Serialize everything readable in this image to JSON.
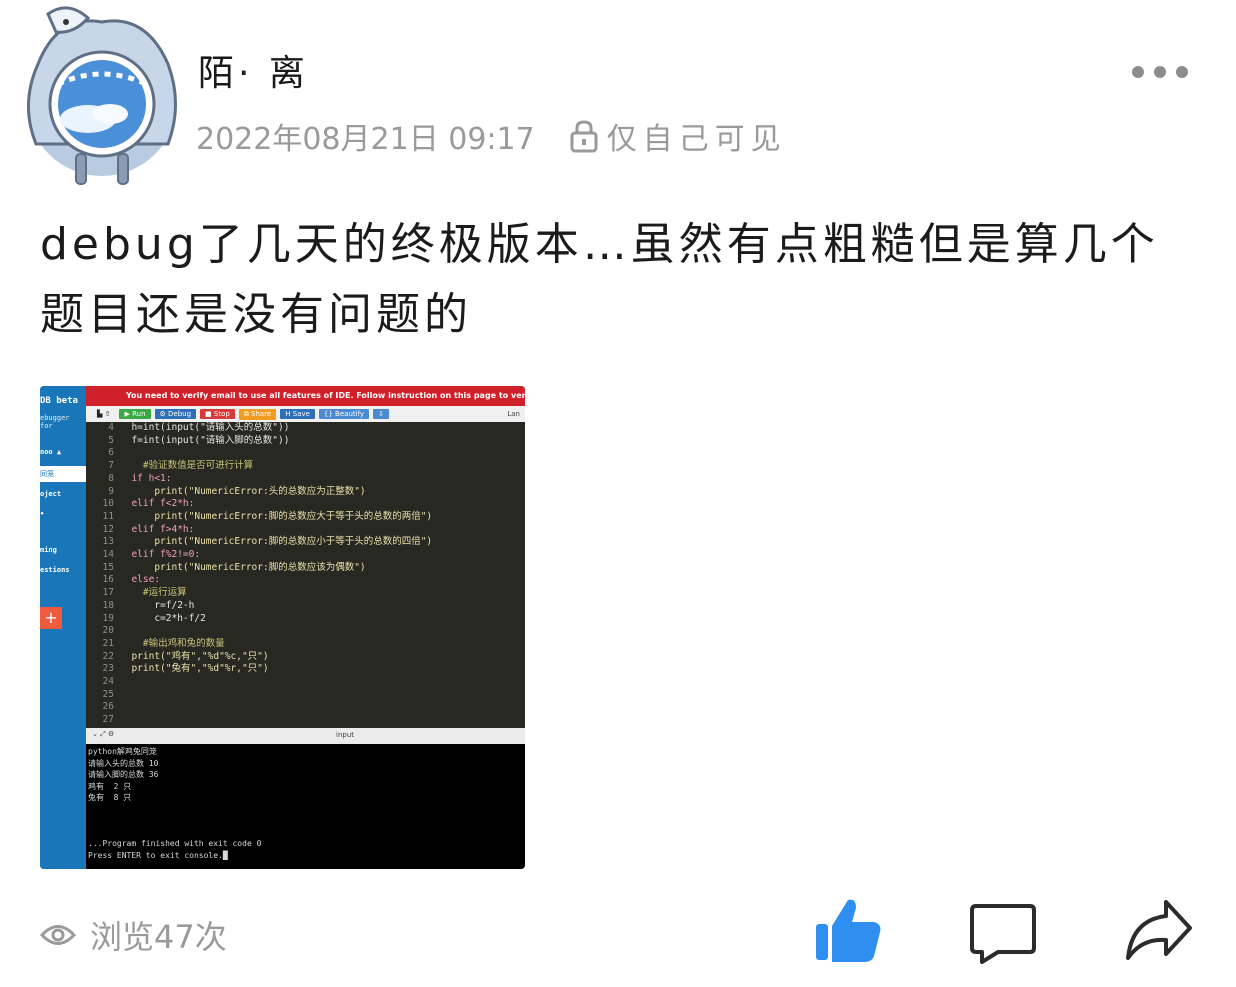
{
  "post": {
    "username": "陌· 离",
    "timestamp": "2022年08月21日 09:17",
    "visibility": "仅自己可见",
    "text": "debug了几天的终极版本…虽然有点粗糙但是算几个题目还是没有问题的",
    "views": "浏览47次",
    "menu_icon": "more-dots-icon"
  },
  "screenshot": {
    "banner": "You need to verify email to use all features of IDE. Follow instruction on this page to verif",
    "sidebar": {
      "logo": "DB beta",
      "subtitle": "ebugger for",
      "user": "noo ▲",
      "selected": "同笼",
      "items": [
        "oject",
        "•",
        "ming",
        "estions"
      ],
      "plus": "+"
    },
    "toolbar": {
      "run": "▶ Run",
      "debug": "⚙ Debug",
      "stop": "■ Stop",
      "share": "⧉ Share",
      "save": "H Save",
      "beautify": "{} Beautify",
      "upload": "⇩",
      "lang": "Lan"
    },
    "code_lines": [
      {
        "n": "4",
        "t": "  h=int(input(\"请输入头的总数\"))"
      },
      {
        "n": "5",
        "t": "  f=int(input(\"请输入脚的总数\"))"
      },
      {
        "n": "6",
        "t": ""
      },
      {
        "n": "7",
        "t": "    #验证数值是否可进行计算"
      },
      {
        "n": "8",
        "t": "  if h<1:"
      },
      {
        "n": "9",
        "t": "      print(\"NumericError:头的总数应为正整数\")"
      },
      {
        "n": "10",
        "t": "  elif f<2*h:"
      },
      {
        "n": "11",
        "t": "      print(\"NumericError:脚的总数应大于等于头的总数的两倍\")"
      },
      {
        "n": "12",
        "t": "  elif f>4*h:"
      },
      {
        "n": "13",
        "t": "      print(\"NumericError:脚的总数应小于等于头的总数的四倍\")"
      },
      {
        "n": "14",
        "t": "  elif f%2!=0:"
      },
      {
        "n": "15",
        "t": "      print(\"NumericError:脚的总数应该为偶数\")"
      },
      {
        "n": "16",
        "t": "  else:"
      },
      {
        "n": "17",
        "t": "    #运行运算"
      },
      {
        "n": "18",
        "t": "      r=f/2-h"
      },
      {
        "n": "19",
        "t": "      c=2*h-f/2"
      },
      {
        "n": "20",
        "t": ""
      },
      {
        "n": "21",
        "t": "    #输出鸡和兔的数量"
      },
      {
        "n": "22",
        "t": "  print(\"鸡有\",\"%d\"%c,\"只\")"
      },
      {
        "n": "23",
        "t": "  print(\"兔有\",\"%d\"%r,\"只\")"
      },
      {
        "n": "24",
        "t": ""
      },
      {
        "n": "25",
        "t": ""
      },
      {
        "n": "26",
        "t": ""
      },
      {
        "n": "27",
        "t": ""
      }
    ],
    "terminal_bar": {
      "icons": "⌄  ⤢  ⚙",
      "label": "input"
    },
    "terminal_lines": [
      "python解鸡兔同笼",
      "请输入头的总数 10",
      "请输入脚的总数 36",
      "鸡有  2 只",
      "兔有  8 只",
      "",
      "",
      "",
      "...Program finished with exit code 0",
      "Press ENTER to exit console.█"
    ]
  },
  "actions": {
    "like_icon": "thumbs-up-icon",
    "comment_icon": "comment-icon",
    "share_icon": "share-icon",
    "like_color": "#2e8ff0"
  }
}
